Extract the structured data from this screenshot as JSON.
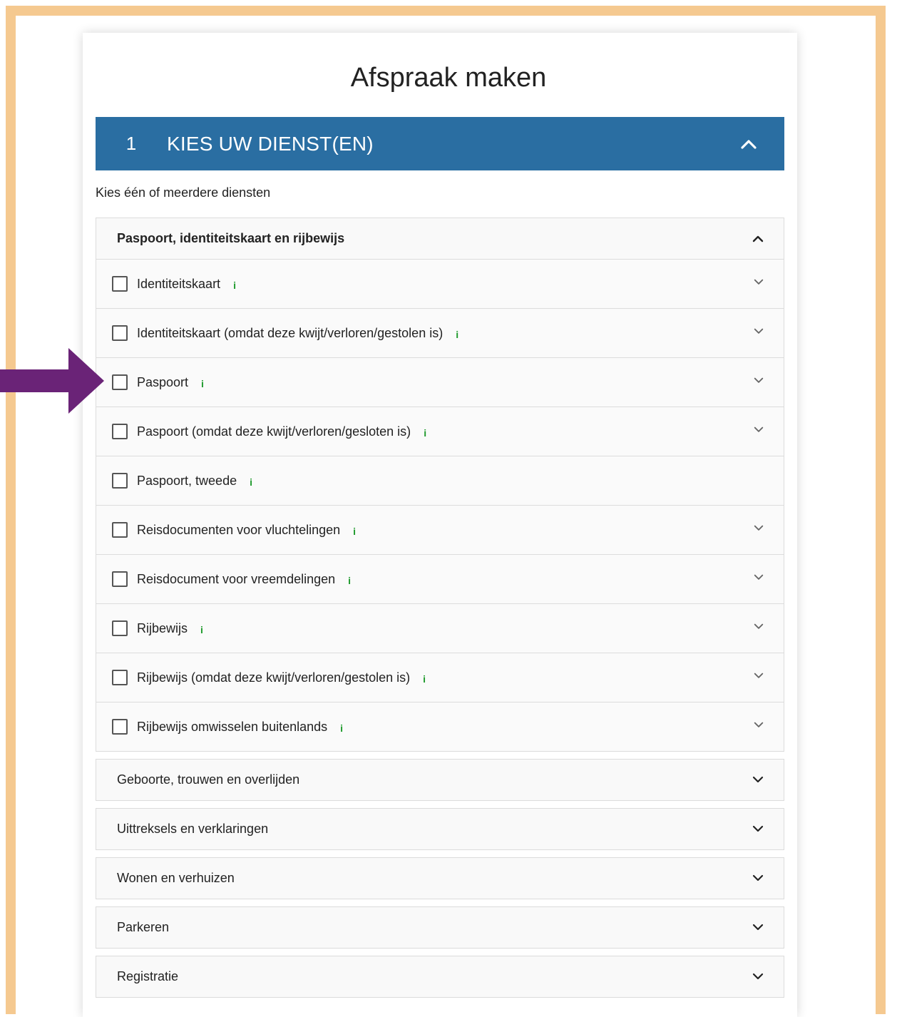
{
  "page": {
    "title": "Afspraak maken",
    "colors": {
      "frame": "#f5c990",
      "header": "#2a6ea2",
      "info": "#1e9a2c",
      "arrow": "#6a2377"
    }
  },
  "step": {
    "number": "1",
    "title": "KIES UW DIENST(EN)"
  },
  "intro": "Kies één of meerdere diensten",
  "open_category": {
    "label": "Paspoort, identiteitskaart en rijbewijs",
    "info_glyph": "i",
    "services": [
      {
        "label": "Identiteitskaart",
        "checked": false,
        "has_chevron": true
      },
      {
        "label": "Identiteitskaart (omdat deze kwijt/verloren/gestolen is)",
        "checked": false,
        "has_chevron": true
      },
      {
        "label": "Paspoort",
        "checked": false,
        "has_chevron": true,
        "highlighted": true
      },
      {
        "label": "Paspoort (omdat deze kwijt/verloren/gesloten is)",
        "checked": false,
        "has_chevron": true
      },
      {
        "label": "Paspoort, tweede",
        "checked": false,
        "has_chevron": false
      },
      {
        "label": "Reisdocumenten voor vluchtelingen",
        "checked": false,
        "has_chevron": true
      },
      {
        "label": "Reisdocument voor vreemdelingen",
        "checked": false,
        "has_chevron": true
      },
      {
        "label": "Rijbewijs",
        "checked": false,
        "has_chevron": true
      },
      {
        "label": "Rijbewijs (omdat deze kwijt/verloren/gestolen is)",
        "checked": false,
        "has_chevron": true
      },
      {
        "label": "Rijbewijs omwisselen buitenlands",
        "checked": false,
        "has_chevron": true
      }
    ]
  },
  "categories": [
    {
      "label": "Geboorte, trouwen en overlijden"
    },
    {
      "label": "Uittreksels en verklaringen"
    },
    {
      "label": "Wonen en verhuizen"
    },
    {
      "label": "Parkeren"
    },
    {
      "label": "Registratie"
    }
  ]
}
